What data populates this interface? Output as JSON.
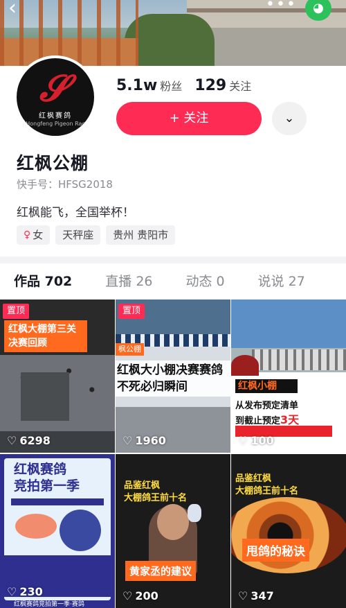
{
  "profile": {
    "followers": "5.1w",
    "followers_label": "粉丝",
    "following": "129",
    "following_label": "关注",
    "follow_button": "+ 关注",
    "name": "红枫公棚",
    "account_id": "快手号：HFSG2018",
    "bio": "红枫能飞，全国举杯！",
    "tags": [
      "女",
      "天秤座",
      "贵州 贵阳市"
    ],
    "avatar_text_cn": "红枫赛鸽",
    "avatar_text_en": "Hongfeng Pigeon Rac"
  },
  "tabs": [
    {
      "label": "作品 702",
      "active": true
    },
    {
      "label": "直播 26",
      "active": false
    },
    {
      "label": "动态 0",
      "active": false
    },
    {
      "label": "说说 27",
      "active": false
    }
  ],
  "videos": [
    {
      "pinned": "置顶",
      "cover_text": "红枫大棚第三关决赛回顾",
      "likes": "6298"
    },
    {
      "pinned": "置顶",
      "sub_label": "枫公棚",
      "cover_text": "红枫大小棚决赛赛鸽不死必归瞬间",
      "likes": "1960"
    },
    {
      "cover_head": "红枫小棚",
      "cover_line1": "从发布预定清单",
      "cover_line2": "到截止预定",
      "cover_line2_hot": "3天",
      "likes": "100"
    },
    {
      "cover_line1": "红枫赛鸽",
      "cover_line2": "竞拍第一季",
      "caption": "红枫赛鸽竞拍第一季·赛鸽",
      "likes": "230"
    },
    {
      "cover_line1": "品鉴红枫",
      "cover_line2": "大棚鸽王前十名",
      "label": "黄家丞的建议",
      "likes": "200"
    },
    {
      "cover_line1": "品鉴红枫",
      "cover_line2": "大棚鸽王前十名",
      "label": "甩鸽的秘诀",
      "likes": "347"
    }
  ],
  "colors": {
    "accent": "#fe2c55",
    "orange": "#ff6a1f",
    "wechat": "#2dc15b"
  },
  "icons": {
    "back": "chevron-left-icon",
    "more": "more-dots-icon",
    "share": "wechat-icon",
    "dropdown": "chevron-down-icon",
    "like": "heart-icon",
    "gender": "female-icon"
  }
}
